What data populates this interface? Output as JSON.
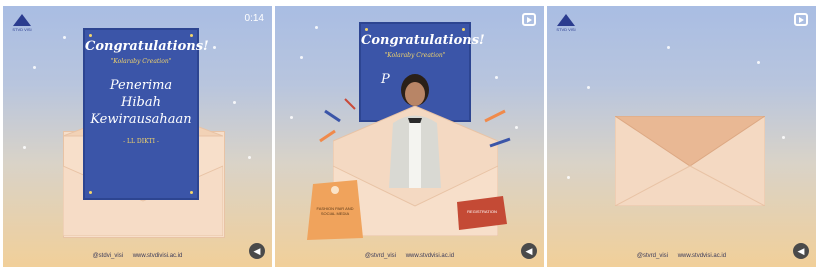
{
  "panels": [
    {
      "timer": "0:14",
      "card": {
        "heading": "Congratulations!",
        "subheading": "\"Kolaraby Creation\"",
        "body_line1": "Penerima",
        "body_line2": "Hibah",
        "body_line3": "Kewirausahaan",
        "footer": "- LL DIKTI -"
      },
      "footer_handle": "@stdvi_visi",
      "footer_site": "www.stvdivisi.ac.id"
    },
    {
      "card": {
        "heading": "Congratulations!",
        "subheading": "\"Kolaraby Creation\"",
        "peek": "P"
      },
      "tag1_text": "FASHION PAIR AND SOCIAL MEDIA",
      "tag2_text": "REGISTRATION",
      "footer_handle": "@stvrd_visi",
      "footer_site": "www.stvdvisi.ac.id"
    },
    {
      "footer_handle": "@stvrd_visi",
      "footer_site": "www.stvdvisi.ac.id"
    }
  ],
  "logo_text": "STVD VISI",
  "sound_icon": "speaker-icon",
  "reel_icon": "reels-icon"
}
